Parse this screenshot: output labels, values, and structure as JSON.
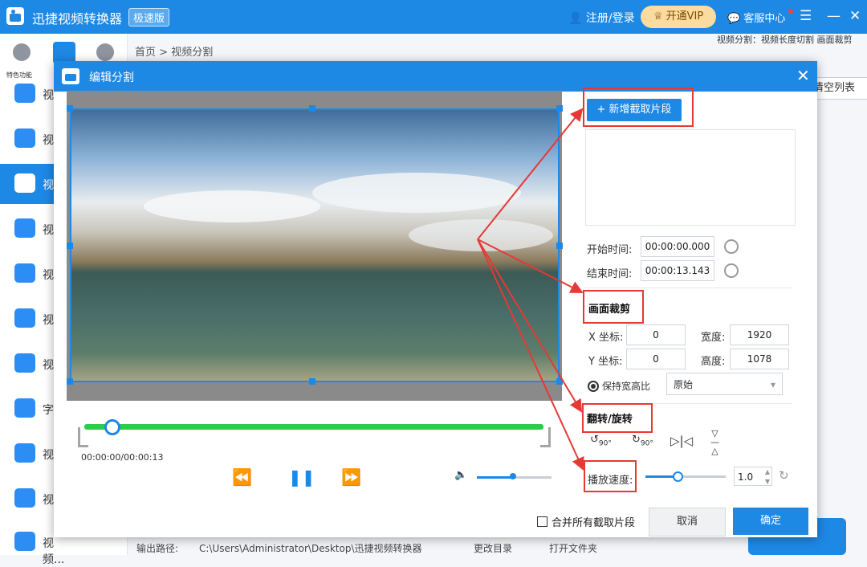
{
  "app": {
    "title": "迅捷视频转换器",
    "edition": "极速版"
  },
  "header": {
    "login": "注册/登录",
    "vip": "开通VIP",
    "service": "客服中心"
  },
  "sidebar": {
    "top_label": "特色功能",
    "items": [
      {
        "label": "视"
      },
      {
        "label": "视"
      },
      {
        "label": "视"
      },
      {
        "label": "视"
      },
      {
        "label": "视"
      },
      {
        "label": "视"
      },
      {
        "label": "视"
      },
      {
        "label": "字"
      },
      {
        "label": "视"
      },
      {
        "label": "视"
      },
      {
        "label": "视频..."
      }
    ]
  },
  "main": {
    "breadcrumb_home": "首页",
    "breadcrumb_current": "视频分割",
    "note": "视频分割：视频长度切割 画面裁剪",
    "clear_list": "清空列表",
    "output_path_label": "输出路径:",
    "output_path": "C:\\Users\\Administrator\\Desktop\\迅捷视频转换器",
    "change_dir": "更改目录",
    "open_folder": "打开文件夹"
  },
  "dialog": {
    "title": "编辑分割",
    "add_segment": "+ 新增截取片段",
    "start_label": "开始时间:",
    "start_value": "00:00:00.000",
    "end_label": "结束时间:",
    "end_value": "00:00:13.143",
    "crop_title": "画面裁剪",
    "x_label": "X 坐标:",
    "x_value": "0",
    "y_label": "Y 坐标:",
    "y_value": "0",
    "width_label": "宽度:",
    "width_value": "1920",
    "height_label": "高度:",
    "height_value": "1078",
    "keep_ratio": "保持宽高比",
    "ratio_option": "原始",
    "flip_title": "翻转/旋转",
    "rotate_ccw": "90°",
    "rotate_cw": "90°",
    "speed_label": "播放速度:",
    "speed_value": "1.0",
    "timecode": "00:00:00/00:00:13",
    "merge_label": "合并所有截取片段",
    "cancel": "取消",
    "ok": "确定"
  },
  "colors": {
    "primary": "#1e88e5",
    "timeline": "#2ccd4a",
    "annotation": "#e53935"
  }
}
